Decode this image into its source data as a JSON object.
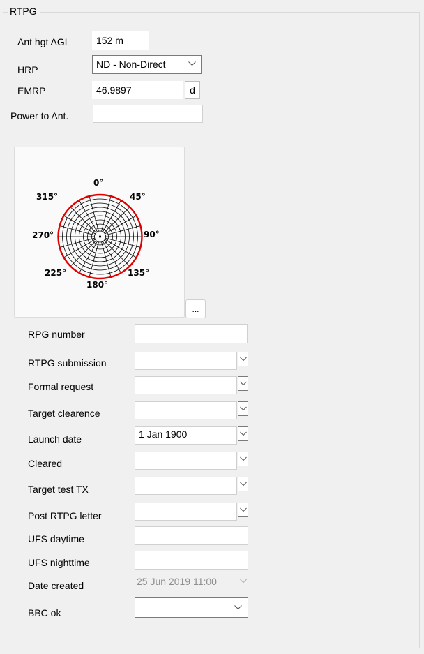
{
  "group": {
    "title": "RTPG"
  },
  "antenna": {
    "ant_hgt_label": "Ant hgt AGL",
    "ant_hgt_value": "152 m",
    "hrp_label": "HRP",
    "hrp_value": "ND - Non-Direct",
    "emrp_label": "EMRP",
    "emrp_value": "46.9897",
    "emrp_unit_button": "d",
    "power_label": "Power to Ant.",
    "power_value": ""
  },
  "polar": {
    "labels": {
      "d0": "0°",
      "d45": "45°",
      "d90": "90°",
      "d135": "135°",
      "d180": "180°",
      "d225": "225°",
      "d270": "270°",
      "d315": "315°"
    },
    "ring_color": "#e00000"
  },
  "ellipsis_button": "...",
  "fields": {
    "rpg_number": {
      "label": "RPG number",
      "value": ""
    },
    "rtpg_submission": {
      "label": "RTPG submission",
      "value": ""
    },
    "formal_request": {
      "label": "Formal request",
      "value": ""
    },
    "target_clearence": {
      "label": "Target clearence",
      "value": ""
    },
    "launch_date": {
      "label": "Launch date",
      "value": "1 Jan 1900"
    },
    "cleared": {
      "label": "Cleared",
      "value": ""
    },
    "target_test_tx": {
      "label": "Target test TX",
      "value": ""
    },
    "post_rtpg_letter": {
      "label": "Post RTPG letter",
      "value": ""
    },
    "ufs_daytime": {
      "label": "UFS daytime",
      "value": ""
    },
    "ufs_nighttime": {
      "label": "UFS nighttime",
      "value": ""
    },
    "date_created": {
      "label": "Date created",
      "value": "25 Jun 2019 11:00"
    },
    "bbc_ok": {
      "label": "BBC ok",
      "value": ""
    }
  }
}
